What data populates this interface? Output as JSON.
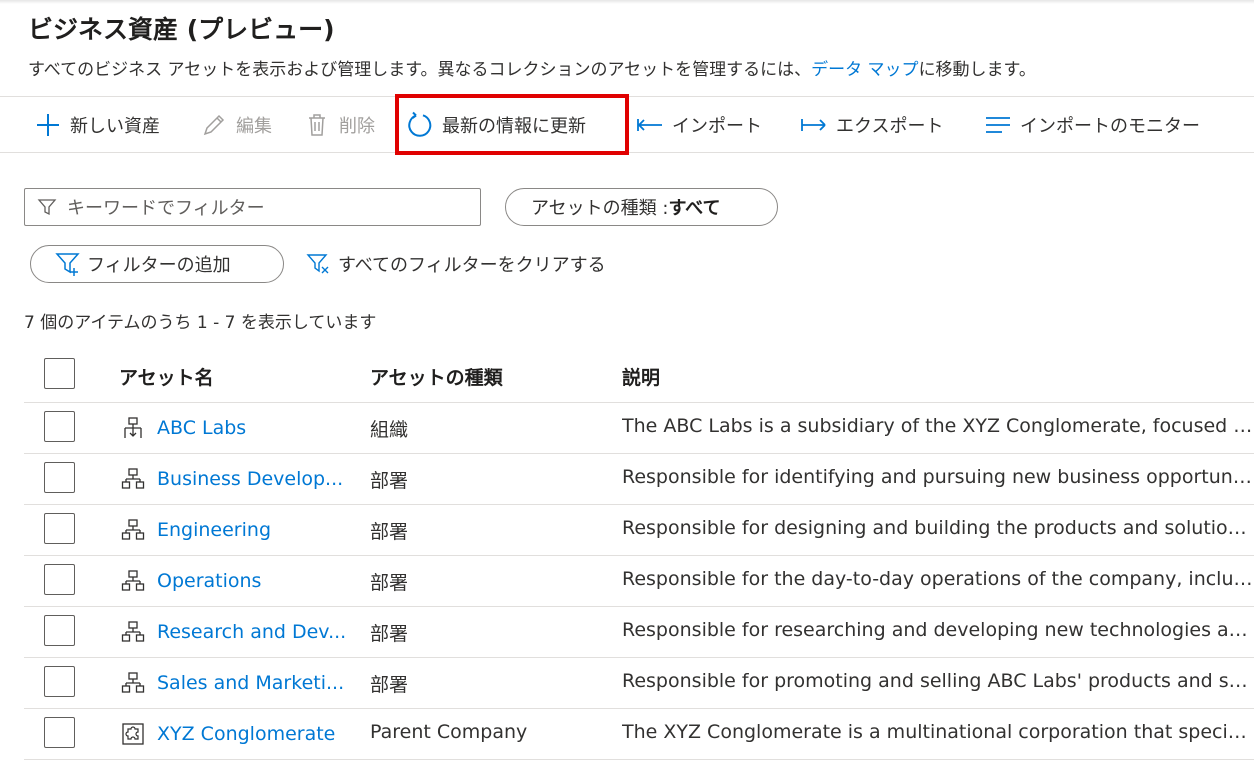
{
  "page": {
    "title": "ビジネス資産 (プレビュー)",
    "description_prefix": "すべてのビジネス アセットを表示および管理します。異なるコレクションのアセットを管理するには、",
    "description_link": "データ マップ",
    "description_suffix": "に移動します。"
  },
  "toolbar": {
    "new_asset": "新しい資産",
    "edit": "編集",
    "delete": "削除",
    "refresh": "最新の情報に更新",
    "import": "インポート",
    "export": "エクスポート",
    "import_monitor": "インポートのモニター"
  },
  "filters": {
    "keyword_placeholder": "キーワードでフィルター",
    "asset_type_label": "アセットの種類 : ",
    "asset_type_value": "すべて",
    "add_filter": "フィルターの追加",
    "clear_all": "すべてのフィルターをクリアする"
  },
  "count_text": "7 個のアイテムのうち 1 - 7 を表示しています",
  "table": {
    "columns": [
      "アセット名",
      "アセットの種類",
      "説明"
    ],
    "rows": [
      {
        "name": "ABC Labs",
        "type": "組織",
        "desc": "The ABC Labs is a subsidiary of the XYZ Conglomerate, focused on p...",
        "icon": "org-icon"
      },
      {
        "name": "Business Develop...",
        "type": "部署",
        "desc": "Responsible for identifying and pursuing new business opportunities...",
        "icon": "department-icon"
      },
      {
        "name": "Engineering",
        "type": "部署",
        "desc": "Responsible for designing and building the products and solutions o...",
        "icon": "department-icon"
      },
      {
        "name": "Operations",
        "type": "部署",
        "desc": "Responsible for the day-to-day operations of the company, includin...",
        "icon": "department-icon"
      },
      {
        "name": "Research and Dev...",
        "type": "部署",
        "desc": "Responsible for researching and developing new technologies and p...",
        "icon": "department-icon"
      },
      {
        "name": "Sales and Marketi...",
        "type": "部署",
        "desc": "Responsible for promoting and selling ABC Labs' products and solut...",
        "icon": "department-icon"
      },
      {
        "name": "XYZ Conglomerate",
        "type": "Parent Company",
        "desc": "The XYZ Conglomerate is a multinational corporation that specialize...",
        "icon": "puzzle-icon"
      }
    ]
  },
  "colors": {
    "accent": "#0078d4",
    "highlight": "#e00000",
    "text": "#323130",
    "disabled": "#a19f9d"
  }
}
